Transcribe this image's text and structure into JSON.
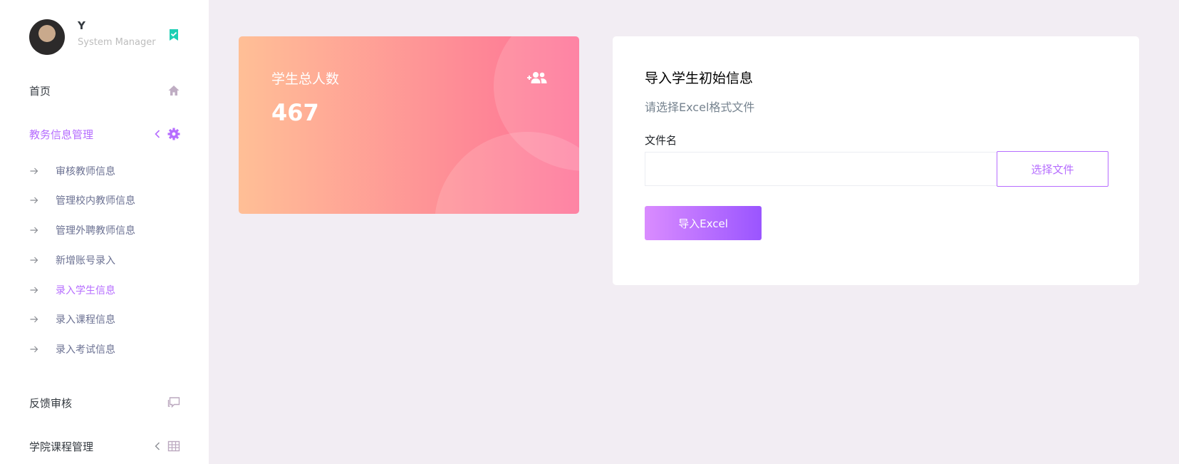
{
  "profile": {
    "name": "Y",
    "role": "System Manager"
  },
  "sidebar": {
    "items": [
      {
        "label": "首页",
        "icon": "home-icon"
      },
      {
        "label": "教务信息管理",
        "icon": "gear-icon",
        "active": true,
        "expanded": true
      },
      {
        "label": "反馈审核",
        "icon": "comment-icon"
      },
      {
        "label": "学院课程管理",
        "icon": "grid-icon"
      }
    ],
    "subitems": [
      {
        "label": "审核教师信息"
      },
      {
        "label": "管理校内教师信息"
      },
      {
        "label": "管理外聘教师信息"
      },
      {
        "label": "新增账号录入"
      },
      {
        "label": "录入学生信息",
        "active": true
      },
      {
        "label": "录入课程信息"
      },
      {
        "label": "录入考试信息"
      }
    ]
  },
  "stat_card": {
    "title": "学生总人数",
    "value": "467",
    "icon": "add-users-icon"
  },
  "import_card": {
    "title": "导入学生初始信息",
    "description": "请选择Excel格式文件",
    "file_label": "文件名",
    "file_value": "",
    "choose_button": "选择文件",
    "import_button": "导入Excel"
  },
  "colors": {
    "accent": "#b66dff",
    "card_gradient_start": "#ffbf96",
    "card_gradient_end": "#fe7096",
    "background": "#f2edf3"
  }
}
